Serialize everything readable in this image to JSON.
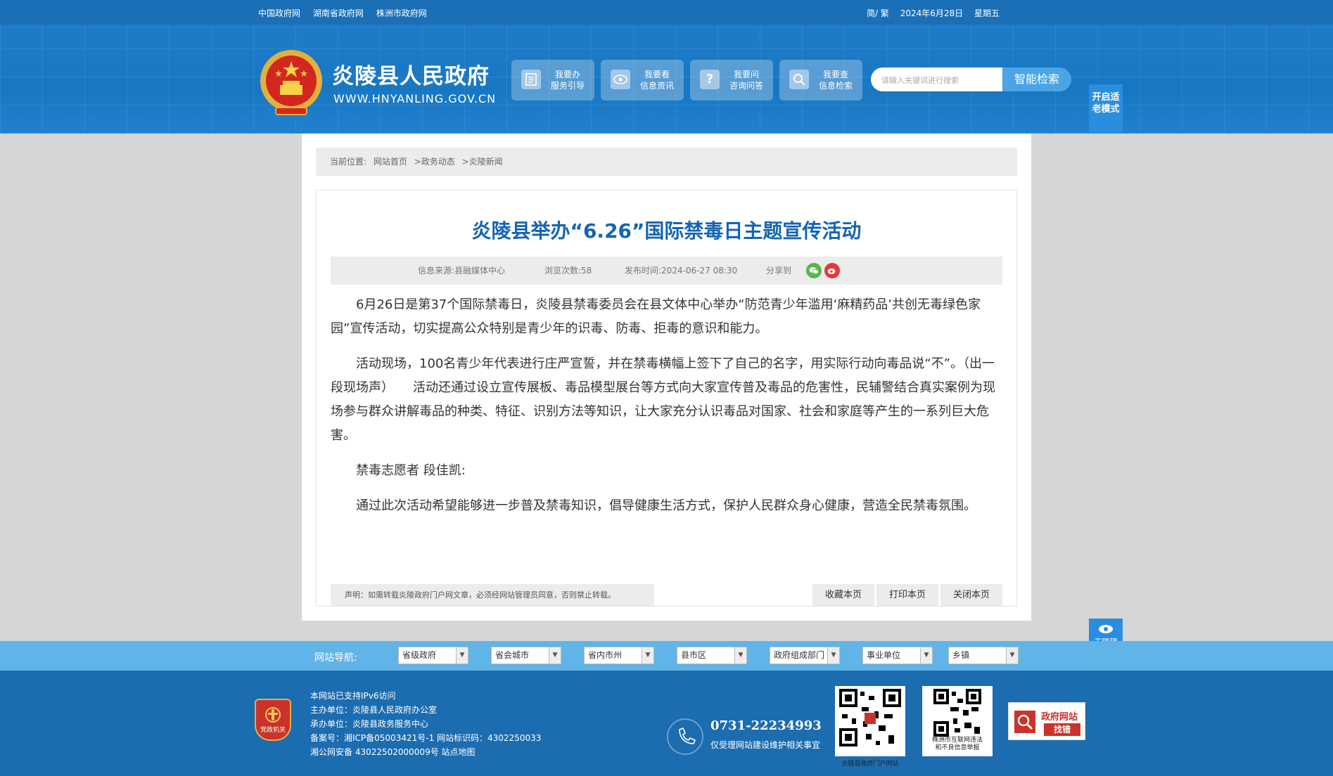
{
  "topbar": {
    "links": [
      "中国政府网",
      "湖南省政府网",
      "株洲市政府网"
    ],
    "lang": "简/ 繁",
    "date": "2024年6月28日",
    "weekday": "星期五"
  },
  "header": {
    "site_name": "炎陵县人民政府",
    "domain": "WWW.HNYANLING.GOV.CN",
    "services": [
      {
        "line1": "我要办",
        "line2": "服务引导",
        "icon": "document-icon"
      },
      {
        "line1": "我要看",
        "line2": "信息资讯",
        "icon": "eye-icon"
      },
      {
        "line1": "我要问",
        "line2": "咨询问答",
        "icon": "question-icon"
      },
      {
        "line1": "我要查",
        "line2": "信息检索",
        "icon": "search-icon"
      }
    ],
    "search_placeholder": "请输入关键词进行搜索",
    "search_button": "智能检索",
    "elder_mode": "开启适老模式"
  },
  "breadcrumb": {
    "label": "当前位置:",
    "items": [
      "网站首页",
      ">政务动态",
      ">炎陵新闻"
    ]
  },
  "article": {
    "title": "炎陵县举办“6.26”国际禁毒日主题宣传活动",
    "source": "信息来源:县融媒体中心",
    "views": "浏览次数:58",
    "published": "发布时间:2024-06-27 08:30",
    "share": "分享到",
    "paragraphs": [
      "6月26日是第37个国际禁毒日，炎陵县禁毒委员会在县文体中心举办“防范青少年滥用‘麻精药品’共创无毒绿色家园”宣传活动，切实提高公众特别是青少年的识毒、防毒、拒毒的意识和能力。",
      "活动现场，100名青少年代表进行庄严宣誓，并在禁毒横幅上签下了自己的名字，用实际行动向毒品说“不”。（出一段现场声）　　活动还通过设立宣传展板、毒品模型展台等方式向大家宣传普及毒品的危害性，民辅警结合真实案例为现场参与群众讲解毒品的种类、特征、识别方法等知识，让大家充分认识毒品对国家、社会和家庭等产生的一系列巨大危害。",
      "禁毒志愿者 段佳凯:",
      "通过此次活动希望能够进一步普及禁毒知识，倡导健康生活方式，保护人民群众身心健康，营造全民禁毒氛围。"
    ],
    "notice": "声明：如需转载炎陵政府门户网文章，必须经网站管理员同意，否则禁止转载。",
    "actions": [
      "收藏本页",
      "打印本页",
      "关闭本页"
    ]
  },
  "accessibility": "无障碍浏览",
  "site_nav": {
    "label": "网站导航:",
    "selects": [
      "省级政府",
      "省会城市",
      "省内市州",
      "县市区",
      "政府组成部门",
      "事业单位",
      "乡镇"
    ]
  },
  "footer": {
    "badge": "党政机关",
    "lines": [
      "本网站已支持IPv6访问",
      "主办单位：炎陵县人民政府办公室",
      "承办单位：炎陵县政务服务中心",
      "备案号：湘ICP备05003421号-1 网站标识码：4302250033",
      "湘公网安备 43022502000009号 站点地图"
    ],
    "phone": "0731-22234993",
    "phone_note": "仅受理网站建设维护相关事宜",
    "qr_labels": [
      "炎陵县政府门户网站",
      "株洲市互联网违法\n和不良信息举报"
    ],
    "error_title": "政府网站",
    "error_btn": "找错"
  }
}
